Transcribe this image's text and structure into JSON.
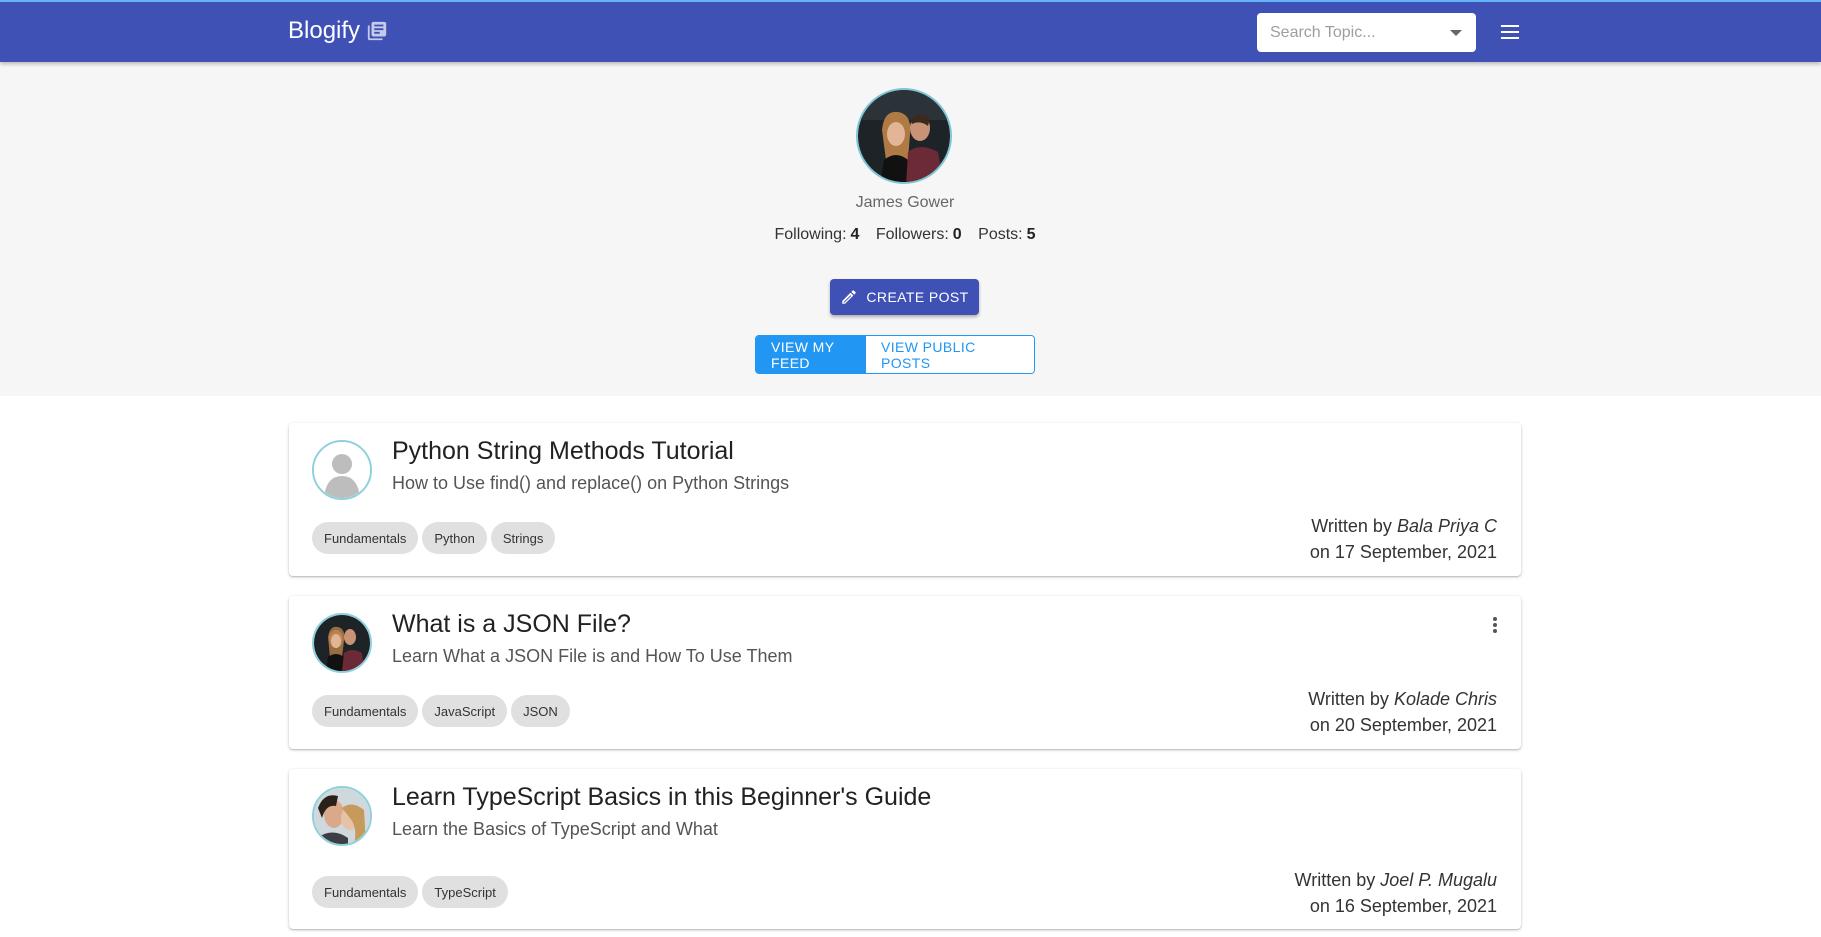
{
  "app": {
    "brand": "Blogify",
    "search_placeholder": "Search Topic..."
  },
  "profile": {
    "name": "James Gower",
    "stats": [
      {
        "label": "Following:",
        "value": "4"
      },
      {
        "label": "Followers:",
        "value": "0"
      },
      {
        "label": "Posts:",
        "value": "5"
      }
    ],
    "create_post_label": "CREATE POST",
    "toggle": {
      "my_feed": "VIEW MY FEED",
      "public_posts": "VIEW PUBLIC POSTS"
    }
  },
  "posts": [
    {
      "title": "Python String Methods Tutorial",
      "subtitle": "How to Use find() and replace() on Python Strings",
      "tags": [
        "Fundamentals",
        "Python",
        "Strings"
      ],
      "written_by_prefix": "Written by",
      "author": "Bala Priya C",
      "date": "on 17 September, 2021",
      "avatar": "default-user-icon"
    },
    {
      "title": "What is a JSON File?",
      "subtitle": "Learn What a JSON File is and How To Use Them",
      "tags": [
        "Fundamentals",
        "JavaScript",
        "JSON"
      ],
      "written_by_prefix": "Written by",
      "author": "Kolade Chris",
      "date": "on 20 September, 2021",
      "avatar": "couple-photo"
    },
    {
      "title": "Learn TypeScript Basics in this Beginner's Guide",
      "subtitle": "Learn the Basics of TypeScript and What",
      "tags": [
        "Fundamentals",
        "TypeScript"
      ],
      "written_by_prefix": "Written by",
      "author": "Joel P. Mugalu",
      "date": "on 16 September, 2021",
      "avatar": "couple-selfie-photo"
    }
  ],
  "colors": {
    "primary": "#3f51b5",
    "accent": "#2196f3",
    "chip": "#e0e0e0",
    "header_bg": "#f6f6f6"
  }
}
